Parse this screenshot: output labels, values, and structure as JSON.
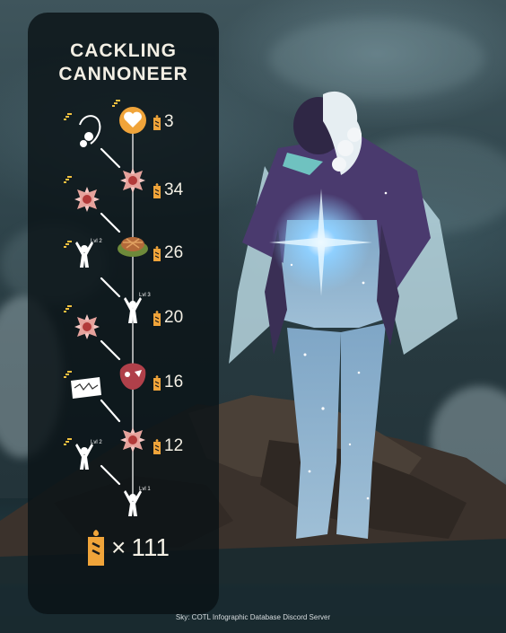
{
  "title_lines": [
    "CACKLING",
    "CANNONEER"
  ],
  "tree": [
    {
      "node": "heart-icon",
      "cost": "3",
      "side": "hair-icon",
      "side_level": ""
    },
    {
      "node": "spark-star-icon",
      "cost": "34",
      "side": "spark-star-icon",
      "side_level": ""
    },
    {
      "node": "pie-icon",
      "cost": "26",
      "side": "emote-icon",
      "side_level": "Lvl 2"
    },
    {
      "node": "emote-icon",
      "node_level": "Lvl 3",
      "cost": "20",
      "side": "spark-star-icon",
      "side_level": ""
    },
    {
      "node": "mask-icon",
      "cost": "16",
      "side": "music-sheet-icon",
      "side_level": ""
    },
    {
      "node": "spark-star-icon",
      "cost": "12",
      "side": "emote-icon",
      "side_level": "Lvl 2"
    },
    {
      "node": "emote-icon",
      "node_level": "Lvl 1",
      "cost": "",
      "side": "",
      "side_level": ""
    }
  ],
  "currency_icon": "candle-icon",
  "total": {
    "symbol": "×",
    "value": "111"
  },
  "credit": "Sky: COTL Infographic Database Discord Server",
  "colors": {
    "panel": "#0a1216",
    "candle": "#f0a43a",
    "text": "#f3efe4",
    "cape": "#4a3a6e",
    "glow": "#9fd8ff"
  }
}
